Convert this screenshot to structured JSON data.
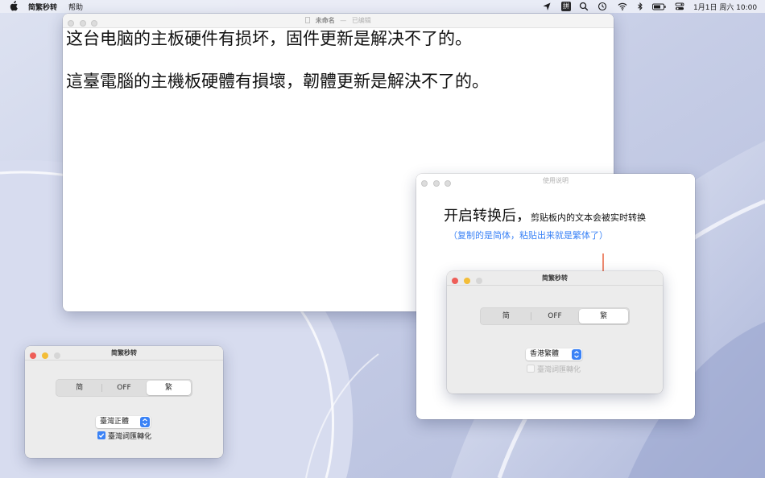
{
  "menubar": {
    "app_name": "简繁秒转",
    "help": "帮助",
    "ime_badge": "拼",
    "clock": "1月1日 周六 10:00",
    "status_icons": [
      "location-arrow-icon",
      "input-method-icon",
      "spotlight-search-icon",
      "time-machine-icon",
      "wifi-icon",
      "bluetooth-icon",
      "battery-icon",
      "control-center-icon"
    ]
  },
  "editor": {
    "title": "未命名",
    "separator": "—",
    "status": "已编辑",
    "lines": [
      "这台电脑的主板硬件有损坏，固件更新是解决不了的。",
      "這臺電腦的主機板硬體有損壞，韌體更新是解決不了的。"
    ]
  },
  "main_panel": {
    "title": "简繁秒转",
    "segments": [
      "简",
      "OFF",
      "繁"
    ],
    "selected_segment": "繁",
    "variant": "臺灣正體",
    "checkbox_label": "臺灣詞匯轉化",
    "checkbox_checked": true
  },
  "instructions": {
    "title": "使用说明",
    "heading_big": "开启转换后，",
    "heading_small": "剪贴板内的文本会被实时转换",
    "subtext": "（复制的是简体，粘贴出来就是繁体了）",
    "demo_panel": {
      "title": "简繁秒转",
      "segments": [
        "简",
        "OFF",
        "繁"
      ],
      "selected_segment": "繁",
      "variant": "香港繁體",
      "checkbox_label": "臺灣詞匯轉化",
      "checkbox_checked": false,
      "checkbox_disabled": true
    }
  },
  "colors": {
    "accent": "#3a82f6",
    "arrow": "#e8623f",
    "close": "#ee5e58",
    "minimize": "#f3bd37"
  }
}
